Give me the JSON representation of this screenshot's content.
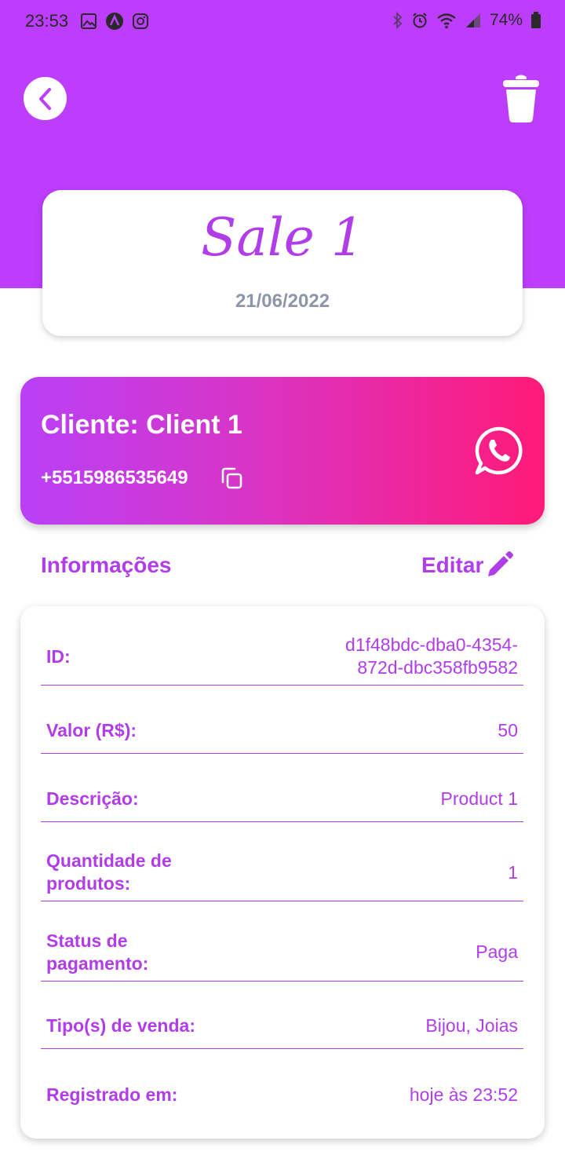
{
  "status_bar": {
    "time": "23:53",
    "battery": "74%"
  },
  "header": {
    "back_icon": "chevron-left-icon",
    "delete_icon": "trash-icon"
  },
  "sale": {
    "title": "Sale 1",
    "date": "21/06/2022"
  },
  "client": {
    "name": "Cliente: Client 1",
    "phone": "+5515986535649"
  },
  "info": {
    "section_title": "Informações",
    "edit_label": "Editar",
    "rows": [
      {
        "label": "ID:",
        "value": "d1f48bdc-dba0-4354-872d-dbc358fb9582"
      },
      {
        "label": "Valor (R$):",
        "value": "50"
      },
      {
        "label": "Descrição:",
        "value": "Product 1"
      },
      {
        "label": "Quantidade de produtos:",
        "value": "1"
      },
      {
        "label": "Status de pagamento:",
        "value": "Paga"
      },
      {
        "label": "Tipo(s) de venda:",
        "value": "Bijou, Joias"
      },
      {
        "label": "Registrado em:",
        "value": "hoje às 23:52"
      }
    ]
  },
  "colors": {
    "brand_purple": "#bc3dfb",
    "text_purple": "#b13de8",
    "gradient_end": "#ff1a78",
    "date_gray": "#8d96a8"
  }
}
